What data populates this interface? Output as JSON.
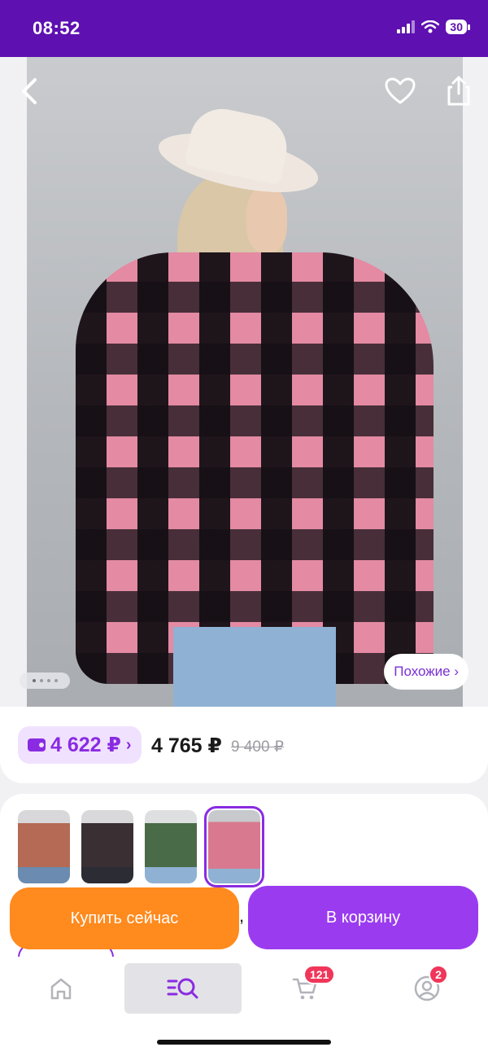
{
  "status_bar": {
    "time": "08:52",
    "battery": "30",
    "icons": [
      "signal-icon",
      "wifi-icon",
      "battery-icon"
    ]
  },
  "header": {
    "icons": [
      "back-arrow-icon",
      "heart-icon",
      "share-icon"
    ]
  },
  "gallery": {
    "similar_label": "Похожие ›",
    "dots_count": 4,
    "active_dot": 1
  },
  "price": {
    "wallet_price": "4 622 ₽",
    "wallet_chevron": "›",
    "current": "4 765 ₽",
    "old": "9 400 ₽"
  },
  "variants": {
    "selected_index": 4,
    "items": [
      "variant-1",
      "variant-2",
      "variant-3",
      "variant-4"
    ]
  },
  "actions": {
    "buy_now": "Купить сейчас",
    "separator": ",",
    "to_cart": "В корзину"
  },
  "tab_bar": {
    "cart_badge": "121",
    "profile_badge": "2",
    "icons": [
      "home-icon",
      "catalog-search-icon",
      "cart-icon",
      "profile-icon"
    ]
  },
  "colors": {
    "brand_purple": "#5e10b1",
    "accent_purple": "#9b3bf0",
    "accent_orange": "#ff8a1e",
    "badge_red": "#f0365a"
  }
}
